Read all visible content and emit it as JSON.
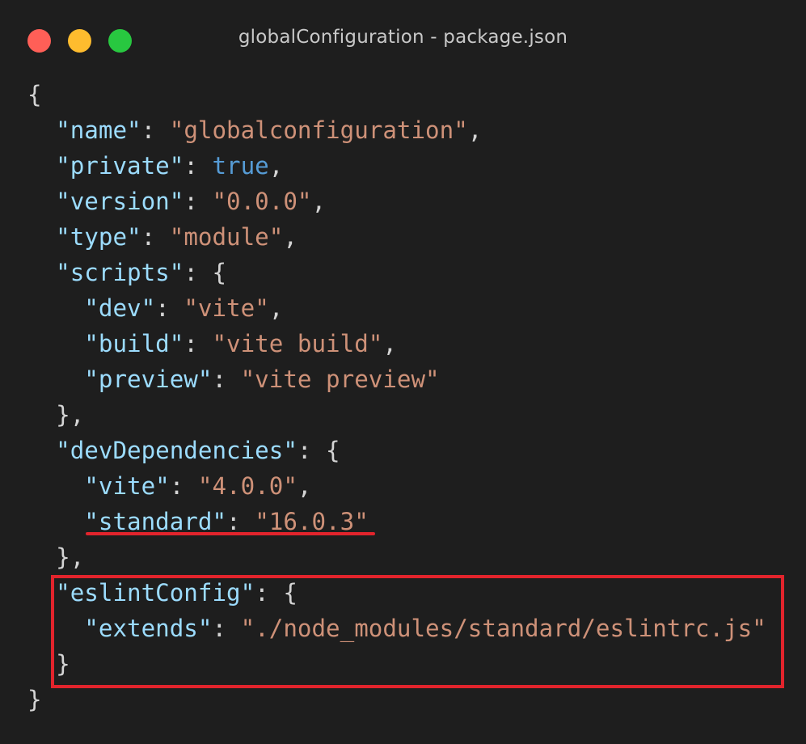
{
  "window": {
    "title": "globalConfiguration - package.json",
    "controls": {
      "close_color": "#ff5f57",
      "minimize_color": "#febc2e",
      "maximize_color": "#28c840"
    }
  },
  "theme": {
    "background": "#1e1e1e",
    "key_color": "#9cdcfe",
    "string_color": "#ce9178",
    "keyword_color": "#569cd6",
    "punctuation_color": "#d4d4d4",
    "annotation_color": "#e2242c"
  },
  "code": {
    "lines": [
      {
        "indent": "",
        "segments": [
          {
            "t": "punc",
            "v": "{"
          }
        ]
      },
      {
        "indent": "  ",
        "segments": [
          {
            "t": "key",
            "v": "\"name\""
          },
          {
            "t": "punc",
            "v": ": "
          },
          {
            "t": "str",
            "v": "\"globalconfiguration\""
          },
          {
            "t": "punc",
            "v": ","
          }
        ]
      },
      {
        "indent": "  ",
        "segments": [
          {
            "t": "key",
            "v": "\"private\""
          },
          {
            "t": "punc",
            "v": ": "
          },
          {
            "t": "kw",
            "v": "true"
          },
          {
            "t": "punc",
            "v": ","
          }
        ]
      },
      {
        "indent": "  ",
        "segments": [
          {
            "t": "key",
            "v": "\"version\""
          },
          {
            "t": "punc",
            "v": ": "
          },
          {
            "t": "str",
            "v": "\"0.0.0\""
          },
          {
            "t": "punc",
            "v": ","
          }
        ]
      },
      {
        "indent": "  ",
        "segments": [
          {
            "t": "key",
            "v": "\"type\""
          },
          {
            "t": "punc",
            "v": ": "
          },
          {
            "t": "str",
            "v": "\"module\""
          },
          {
            "t": "punc",
            "v": ","
          }
        ]
      },
      {
        "indent": "  ",
        "segments": [
          {
            "t": "key",
            "v": "\"scripts\""
          },
          {
            "t": "punc",
            "v": ": {"
          }
        ]
      },
      {
        "indent": "    ",
        "segments": [
          {
            "t": "key",
            "v": "\"dev\""
          },
          {
            "t": "punc",
            "v": ": "
          },
          {
            "t": "str",
            "v": "\"vite\""
          },
          {
            "t": "punc",
            "v": ","
          }
        ]
      },
      {
        "indent": "    ",
        "segments": [
          {
            "t": "key",
            "v": "\"build\""
          },
          {
            "t": "punc",
            "v": ": "
          },
          {
            "t": "str",
            "v": "\"vite build\""
          },
          {
            "t": "punc",
            "v": ","
          }
        ]
      },
      {
        "indent": "    ",
        "segments": [
          {
            "t": "key",
            "v": "\"preview\""
          },
          {
            "t": "punc",
            "v": ": "
          },
          {
            "t": "str",
            "v": "\"vite preview\""
          }
        ]
      },
      {
        "indent": "  ",
        "segments": [
          {
            "t": "punc",
            "v": "},"
          }
        ]
      },
      {
        "indent": "  ",
        "segments": [
          {
            "t": "key",
            "v": "\"devDependencies\""
          },
          {
            "t": "punc",
            "v": ": {"
          }
        ]
      },
      {
        "indent": "    ",
        "segments": [
          {
            "t": "key",
            "v": "\"vite\""
          },
          {
            "t": "punc",
            "v": ": "
          },
          {
            "t": "str",
            "v": "\"4.0.0\""
          },
          {
            "t": "punc",
            "v": ","
          }
        ]
      },
      {
        "indent": "    ",
        "segments": [
          {
            "t": "key",
            "v": "\"standard\""
          },
          {
            "t": "punc",
            "v": ": "
          },
          {
            "t": "str",
            "v": "\"16.0.3\""
          }
        ]
      },
      {
        "indent": "  ",
        "segments": [
          {
            "t": "punc",
            "v": "},"
          }
        ]
      },
      {
        "indent": "  ",
        "segments": [
          {
            "t": "key",
            "v": "\"eslintConfig\""
          },
          {
            "t": "punc",
            "v": ": {"
          }
        ]
      },
      {
        "indent": "    ",
        "segments": [
          {
            "t": "key",
            "v": "\"extends\""
          },
          {
            "t": "punc",
            "v": ": "
          },
          {
            "t": "str",
            "v": "\"./node_modules/standard/eslintrc.js\""
          }
        ]
      },
      {
        "indent": "  ",
        "segments": [
          {
            "t": "punc",
            "v": "}"
          }
        ]
      },
      {
        "indent": "",
        "segments": [
          {
            "t": "punc",
            "v": "}"
          }
        ]
      }
    ]
  }
}
